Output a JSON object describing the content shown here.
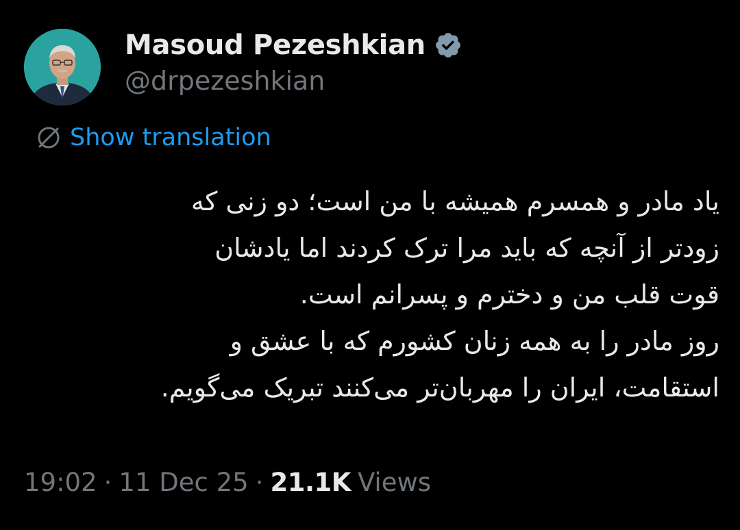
{
  "author": {
    "display_name": "Masoud Pezeshkian",
    "handle": "@drpezeshkian",
    "verified": true,
    "avatar_icon": "profile-photo"
  },
  "translation": {
    "label": "Show translation",
    "icon": "globe-icon",
    "color": "#1d9bf0"
  },
  "tweet": {
    "lines": [
      "یاد مادر و همسرم همیشه با من است؛ دو زنی که",
      "زودتر از آنچه که باید مرا ترک کردند اما یادشان",
      "قوت قلب من و دخترم و پسرانم است.",
      "روز مادر را به همه زنان کشورم که با عشق و",
      "استقامت، ایران را مهربان‌تر می‌کنند تبریک می‌گویم."
    ]
  },
  "meta": {
    "time": "19:02",
    "separator": "·",
    "date": "11 Dec 25",
    "views_count": "21.1K",
    "views_label": "Views"
  },
  "colors": {
    "background": "#000000",
    "text": "#e7e9ea",
    "muted": "#71767b",
    "accent": "#1d9bf0",
    "avatar_bg": "#2aa3a0"
  }
}
